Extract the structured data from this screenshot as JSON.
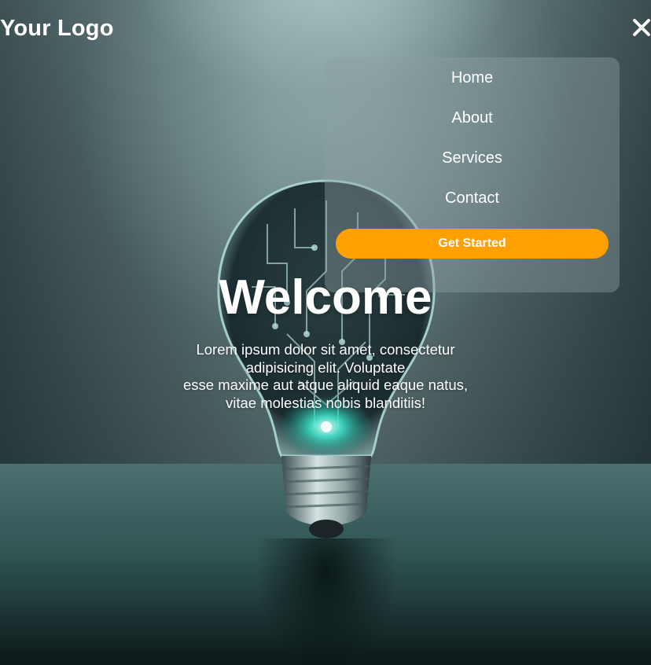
{
  "header": {
    "logo_text": "Your Logo",
    "close_icon": "close-icon"
  },
  "menu": {
    "items": [
      {
        "label": "Home"
      },
      {
        "label": "About"
      },
      {
        "label": "Services"
      },
      {
        "label": "Contact"
      }
    ],
    "cta_label": "Get Started",
    "cta_color": "#ffa000"
  },
  "hero": {
    "title": "Welcome",
    "lead_lines": [
      "Lorem ipsum dolor sit amet, consectetur",
      "adipisicing elit. Voluptate",
      "esse maxime aut atque aliquid eaque natus,",
      "vitae molestias nobis blanditiis!"
    ],
    "background_image": "light-bulb-circuit-image"
  }
}
